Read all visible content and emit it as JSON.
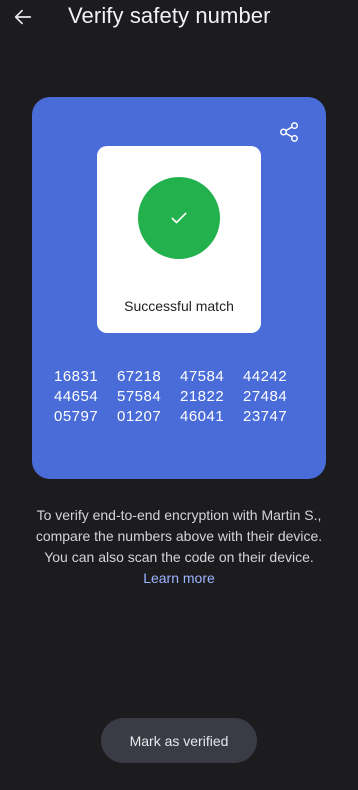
{
  "header": {
    "back_icon": "arrow-left-icon",
    "title": "Verify safety number"
  },
  "card": {
    "background_color": "#4a6cd8",
    "share_icon": "share-icon",
    "match": {
      "status_icon": "checkmark-icon",
      "status_color": "#22b14c",
      "label": "Successful match"
    },
    "numbers": [
      "16831",
      "67218",
      "47584",
      "44242",
      "44654",
      "57584",
      "21822",
      "27484",
      "05797",
      "01207",
      "46041",
      "23747"
    ]
  },
  "description": {
    "line1": "To verify end-to-end encryption with Martin S.,",
    "line2": "compare the numbers above with their device.",
    "line3": "You can also scan the code on their device.",
    "learn_more": "Learn more"
  },
  "actions": {
    "mark_verified_label": "Mark as verified"
  }
}
